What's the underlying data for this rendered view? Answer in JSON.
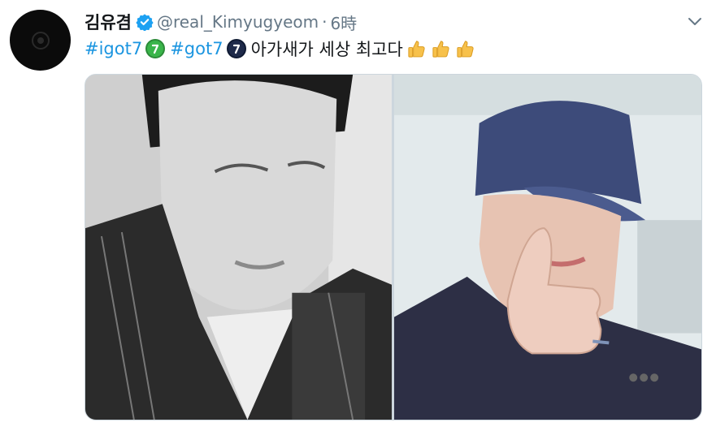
{
  "author": {
    "display_name": "김유겸",
    "handle": "@real_Kimyugyeom",
    "separator": "·",
    "timestamp": "6時",
    "verified": true,
    "avatar_icon": "got7-logo-icon"
  },
  "tweet": {
    "hashtag_1": "#igot7",
    "hashtag_2": "#got7",
    "body": "아가새가 세상 최고다",
    "emojis": [
      "got7-green-emoji",
      "got7-navy-emoji",
      "thumbs-up",
      "thumbs-up",
      "thumbs-up"
    ]
  },
  "media": {
    "photos": [
      {
        "name": "photo-left",
        "description_icon": "grayscale-selfie"
      },
      {
        "name": "photo-right",
        "description_icon": "cap-thumbs-up-selfie"
      }
    ]
  },
  "colors": {
    "link": "#1b95e0",
    "secondary_text": "#657786",
    "verified_badge": "#1da1f2",
    "border": "#ccd6dd"
  }
}
